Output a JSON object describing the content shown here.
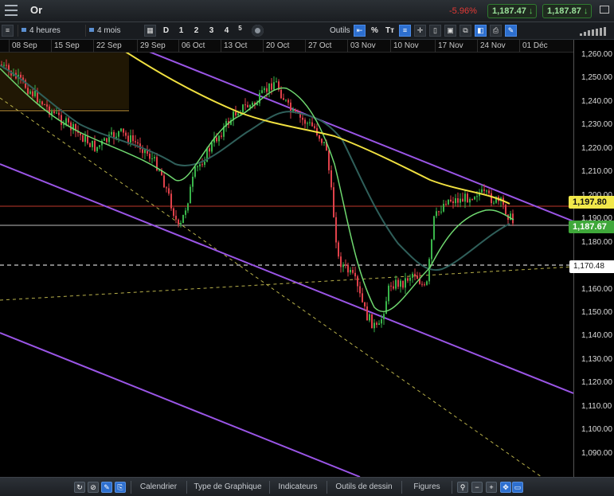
{
  "window": {
    "title": "Or",
    "change": "-5.96%",
    "sell_price": "1,187.47",
    "buy_price": "1,187.87"
  },
  "toolbar": {
    "period": "4 heures",
    "range": "4 mois",
    "period_buttons": [
      "D",
      "1",
      "2",
      "3",
      "4",
      "5"
    ],
    "tools_label": "Outils",
    "percent_label": "%",
    "text_label": "Tт"
  },
  "date_axis": [
    "08 Sep",
    "15 Sep",
    "22 Sep",
    "29 Sep",
    "06 Oct",
    "13 Oct",
    "20 Oct",
    "27 Oct",
    "03 Nov",
    "10 Nov",
    "17 Nov",
    "24 Nov",
    "01 Déc"
  ],
  "price_axis": [
    "1,260.00",
    "1,250.00",
    "1,240.00",
    "1,230.00",
    "1,220.00",
    "1,210.00",
    "1,200.00",
    "1,190.00",
    "1,180.00",
    "1,170.00",
    "1,160.00",
    "1,150.00",
    "1,140.00",
    "1,130.00",
    "1,120.00",
    "1,110.00",
    "1,100.00",
    "1,090.00"
  ],
  "price_tags": {
    "moving_average": "1,197.80",
    "last_price": "1,187.67",
    "support_line": "1,170.48"
  },
  "bottom_menu": [
    "Calendrier",
    "Type de Graphique",
    "Indicateurs",
    "Outils de dessin",
    "Figures"
  ],
  "colors": {
    "up": "#39b54a",
    "down": "#e0414a",
    "ma_long": "#f0e040",
    "ma_mid": "#2f5f5a",
    "ma_short": "#6fd86f",
    "channel": "#9a55e6",
    "accent": "#2d6fcf"
  },
  "icons": {
    "menu": "hamburger-menu-icon",
    "settings": "gear-icon",
    "zoom": "magnifier-icon"
  }
}
